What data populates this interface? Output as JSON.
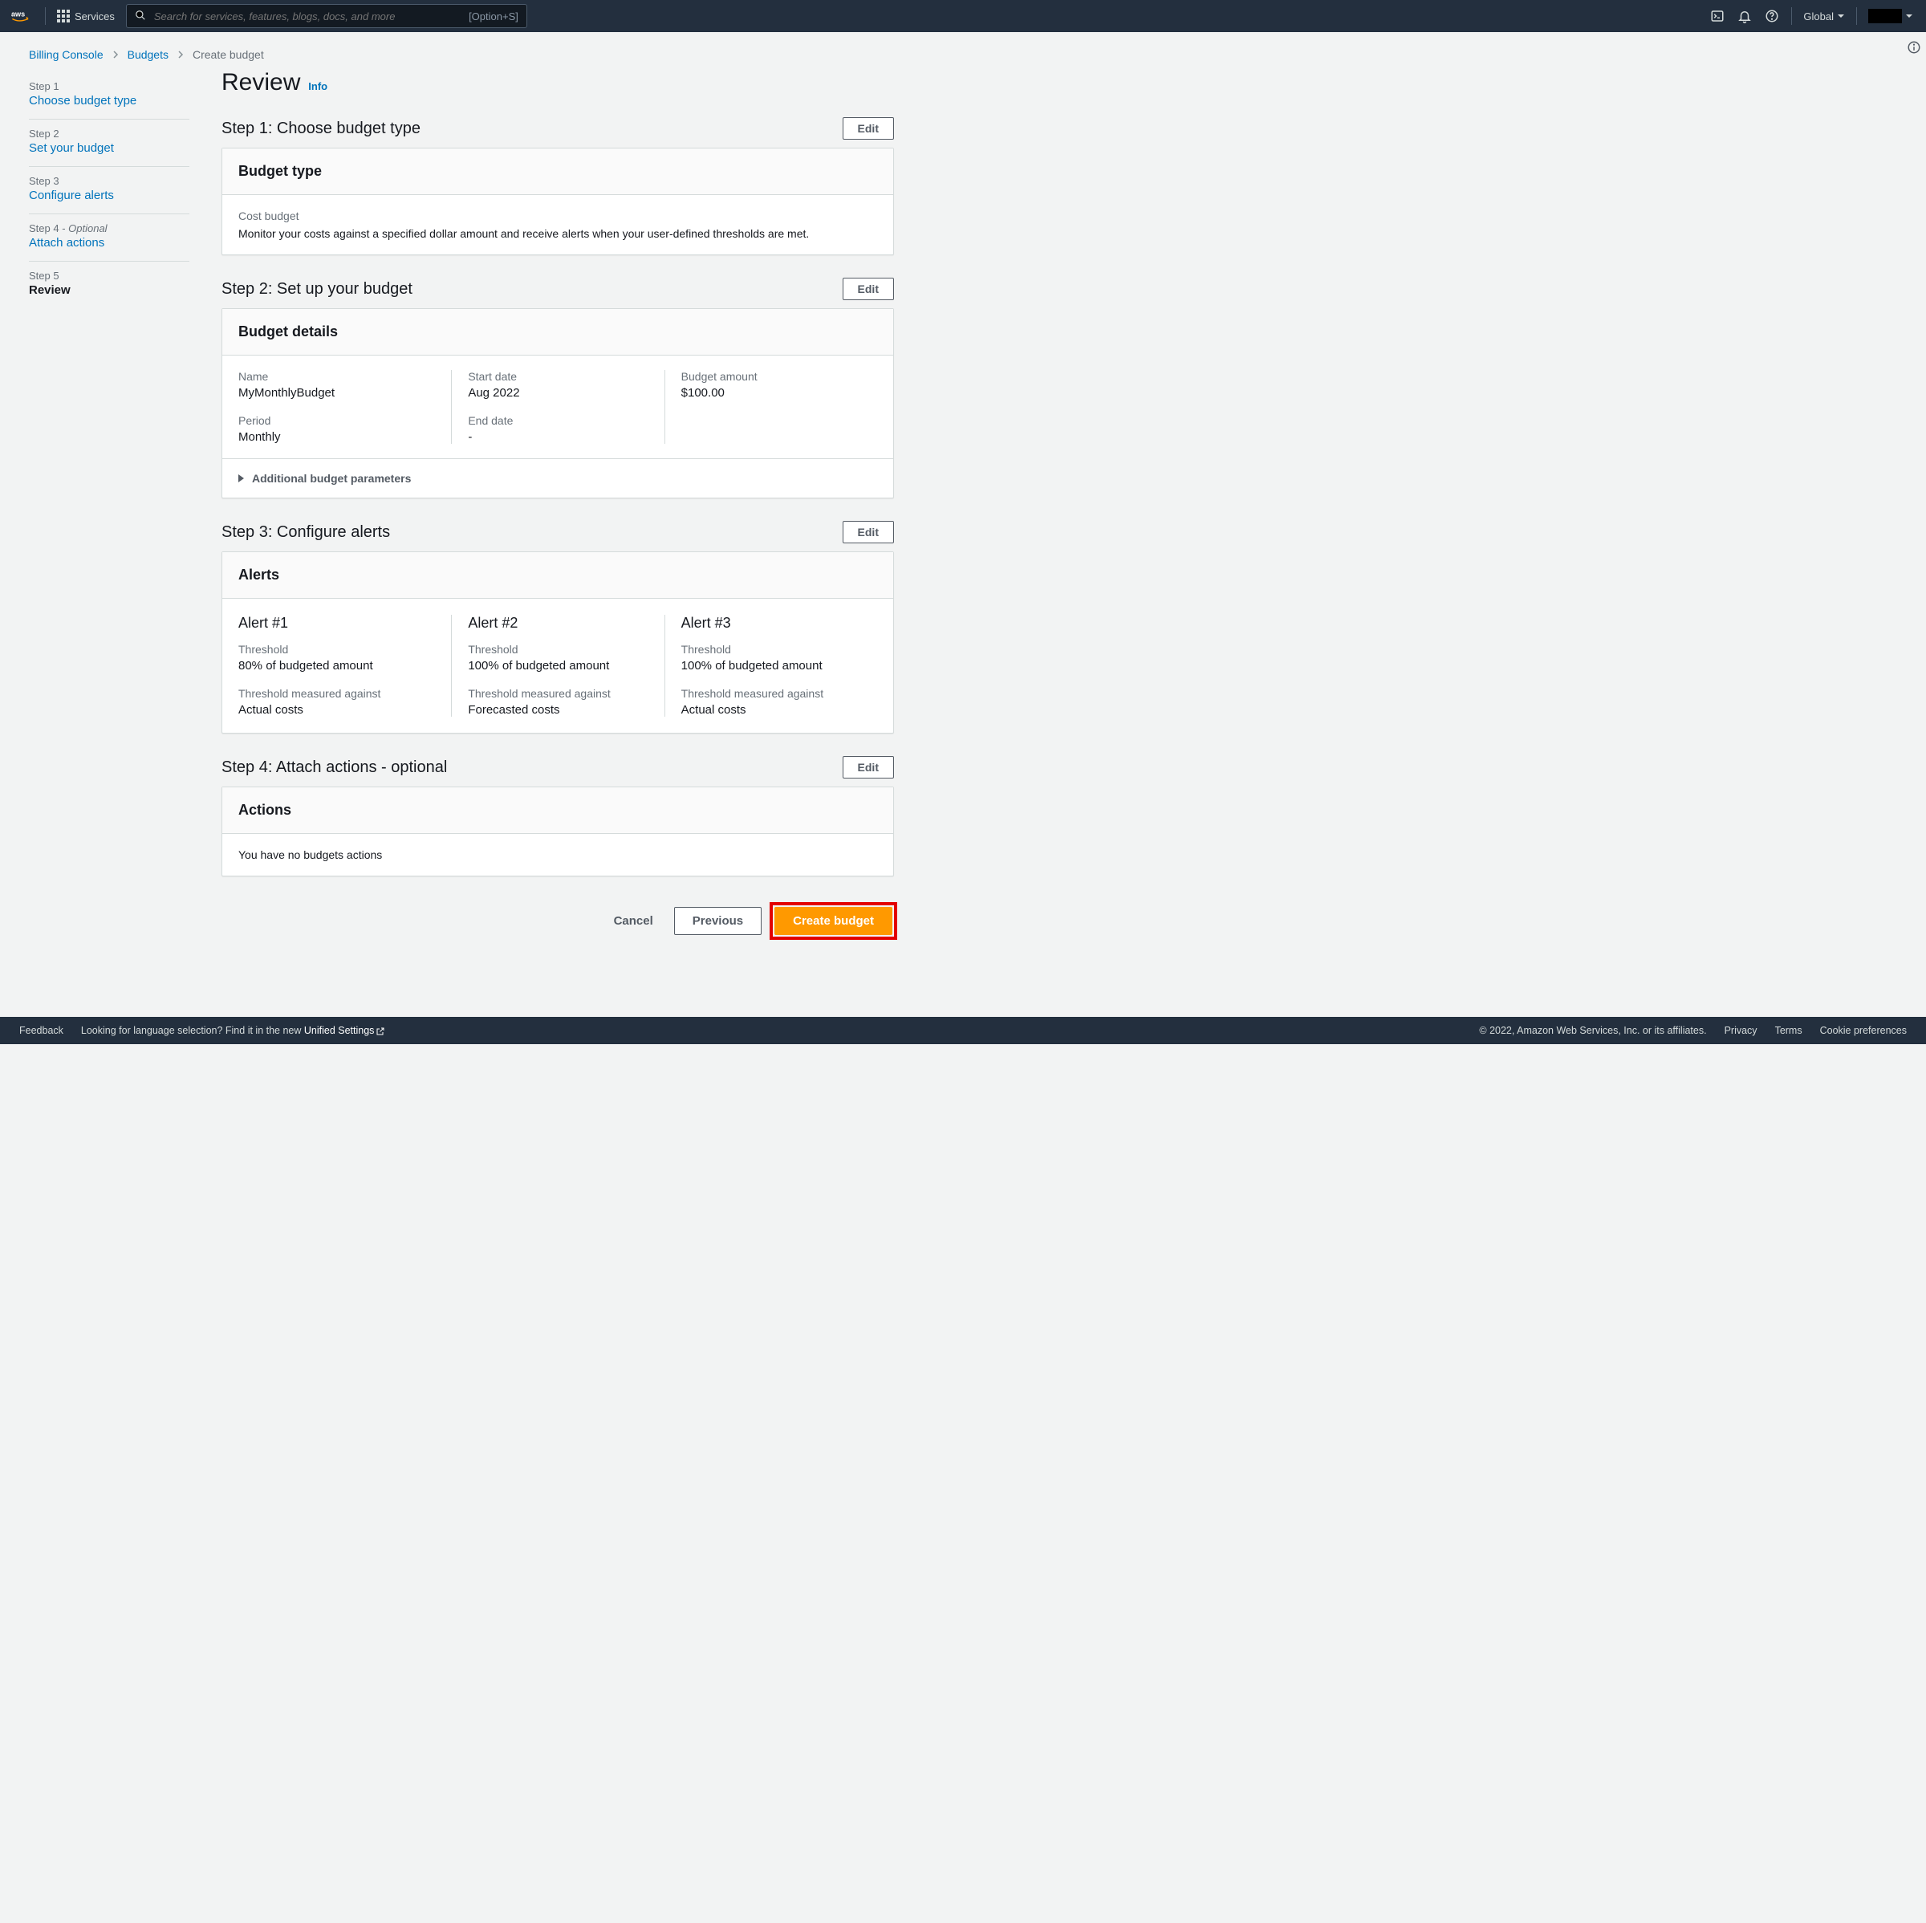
{
  "nav": {
    "services_label": "Services",
    "search_placeholder": "Search for services, features, blogs, docs, and more",
    "search_shortcut": "[Option+S]",
    "region": "Global"
  },
  "breadcrumb": {
    "a": "Billing Console",
    "b": "Budgets",
    "c": "Create budget"
  },
  "sidebar": {
    "s1": {
      "num": "Step 1",
      "label": "Choose budget type"
    },
    "s2": {
      "num": "Step 2",
      "label": "Set your budget"
    },
    "s3": {
      "num": "Step 3",
      "label": "Configure alerts"
    },
    "s4": {
      "num": "Step 4 - ",
      "opt": "Optional",
      "label": "Attach actions"
    },
    "s5": {
      "num": "Step 5",
      "label": "Review"
    }
  },
  "header": {
    "title": "Review",
    "info": "Info"
  },
  "buttons": {
    "edit": "Edit",
    "cancel": "Cancel",
    "previous": "Previous",
    "create": "Create budget"
  },
  "step1": {
    "title": "Step 1: Choose budget type",
    "panel_title": "Budget type",
    "type_name": "Cost budget",
    "type_desc": "Monitor your costs against a specified dollar amount and receive alerts when your user-defined thresholds are met."
  },
  "step2": {
    "title": "Step 2: Set up your budget",
    "panel_title": "Budget details",
    "labels": {
      "name": "Name",
      "period": "Period",
      "start": "Start date",
      "end": "End date",
      "amount": "Budget amount"
    },
    "values": {
      "name": "MyMonthlyBudget",
      "period": "Monthly",
      "start": "Aug 2022",
      "end": "-",
      "amount": "$100.00"
    },
    "expander": "Additional budget parameters"
  },
  "step3": {
    "title": "Step 3: Configure alerts",
    "panel_title": "Alerts",
    "labels": {
      "threshold": "Threshold",
      "measured": "Threshold measured against"
    },
    "alerts": [
      {
        "title": "Alert #1",
        "threshold": "80% of budgeted amount",
        "measured": "Actual costs"
      },
      {
        "title": "Alert #2",
        "threshold": "100% of budgeted amount",
        "measured": "Forecasted costs"
      },
      {
        "title": "Alert #3",
        "threshold": "100% of budgeted amount",
        "measured": "Actual costs"
      }
    ]
  },
  "step4": {
    "title": "Step 4: Attach actions - optional",
    "panel_title": "Actions",
    "body": "You have no budgets actions"
  },
  "footer": {
    "feedback": "Feedback",
    "lang_prefix": "Looking for language selection? Find it in the new ",
    "lang_link": "Unified Settings",
    "copyright": "© 2022, Amazon Web Services, Inc. or its affiliates.",
    "privacy": "Privacy",
    "terms": "Terms",
    "cookies": "Cookie preferences"
  }
}
